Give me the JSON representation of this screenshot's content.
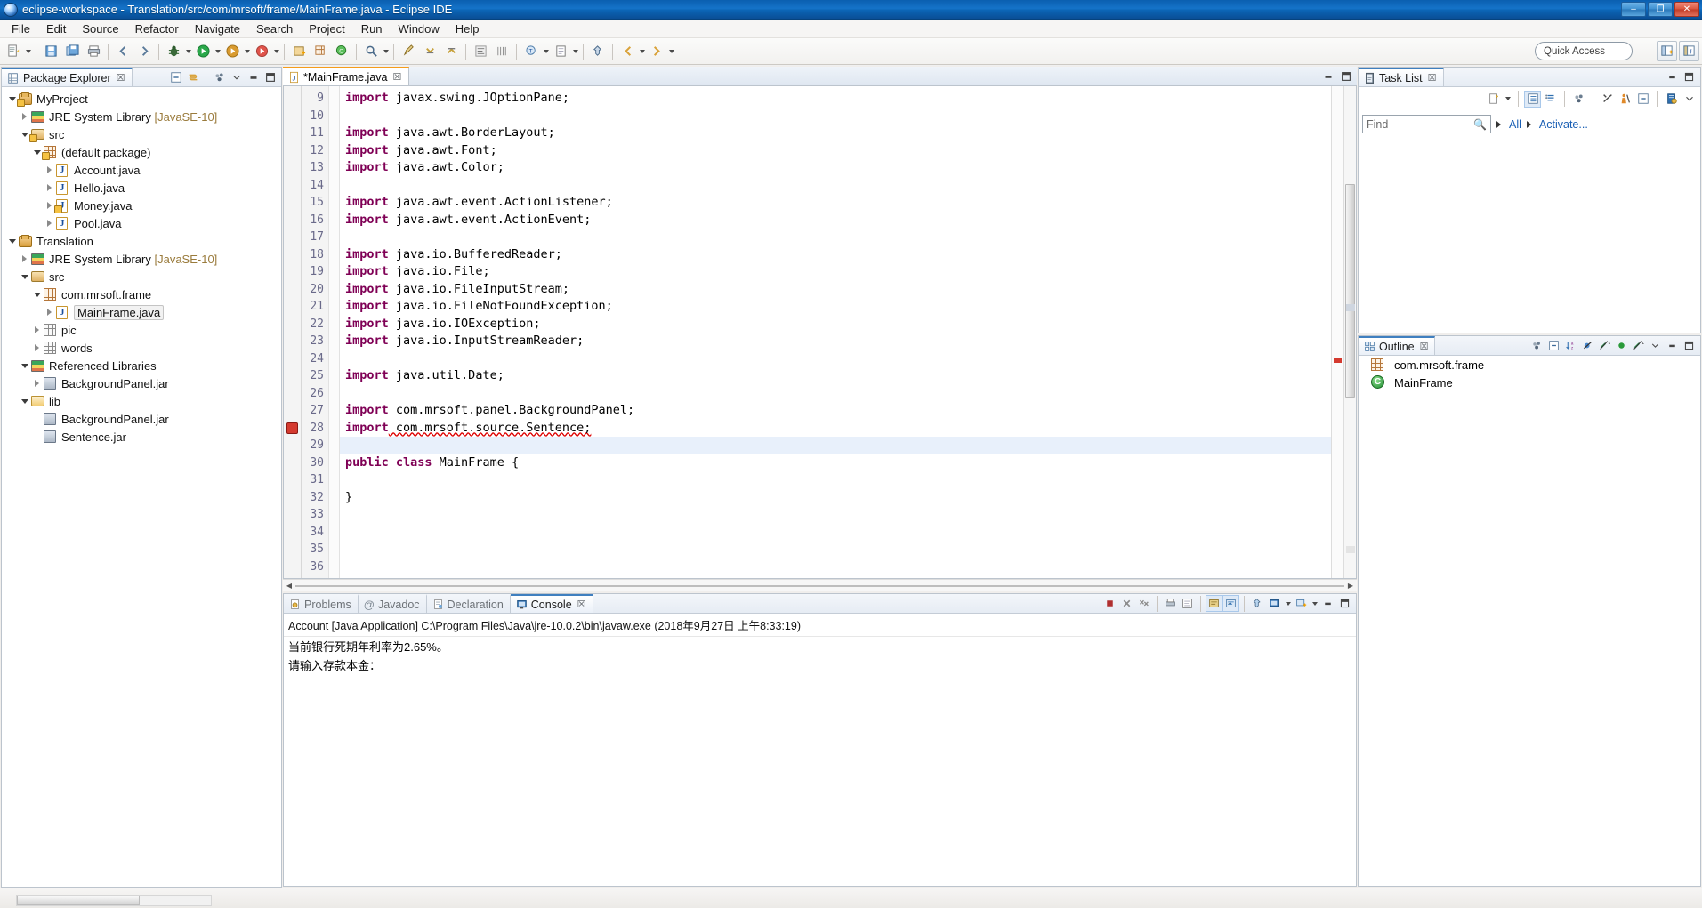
{
  "window": {
    "title": "eclipse-workspace - Translation/src/com/mrsoft/frame/MainFrame.java - Eclipse IDE",
    "minimize_label": "–",
    "maximize_label": "❐",
    "close_label": "✕"
  },
  "menubar": {
    "items": [
      "File",
      "Edit",
      "Source",
      "Refactor",
      "Navigate",
      "Search",
      "Project",
      "Run",
      "Window",
      "Help"
    ]
  },
  "toolbar": {
    "quick_access_placeholder": "Quick Access",
    "icons": [
      "new-icon",
      "new-dropdown",
      "save-icon",
      "save-all-icon",
      "print-icon",
      "debug-icon",
      "run-icon",
      "run-dropdown",
      "coverage-icon",
      "external-tools-icon",
      "new-java-project-icon",
      "new-package-icon",
      "new-class-icon",
      "search-icon",
      "open-type-icon",
      "back-icon",
      "forward-icon"
    ],
    "perspective_buttons": [
      "open-perspective-icon",
      "java-perspective-icon"
    ]
  },
  "package_explorer": {
    "tab_label": "Package Explorer",
    "tab_close": "☒",
    "toolbar_icons": [
      "collapse-all-icon",
      "link-with-editor-icon",
      "view-menu-icon",
      "minimize-icon",
      "maximize-icon"
    ],
    "tree": [
      {
        "label": "MyProject",
        "suffix": "",
        "depth": 0,
        "arrow": "expanded",
        "icon": "project-icon",
        "warn": true
      },
      {
        "label": "JRE System Library ",
        "suffix": "[JavaSE-10]",
        "depth": 1,
        "arrow": "collapsed",
        "icon": "library-icon",
        "warn": false
      },
      {
        "label": "src",
        "suffix": "",
        "depth": 1,
        "arrow": "expanded",
        "icon": "source-folder-icon",
        "warn": true
      },
      {
        "label": "(default package)",
        "suffix": "",
        "depth": 2,
        "arrow": "expanded",
        "icon": "package-icon",
        "warn": true
      },
      {
        "label": "Account.java",
        "suffix": "",
        "depth": 3,
        "arrow": "collapsed",
        "icon": "java-file-icon",
        "warn": false
      },
      {
        "label": "Hello.java",
        "suffix": "",
        "depth": 3,
        "arrow": "collapsed",
        "icon": "java-file-icon",
        "warn": false
      },
      {
        "label": "Money.java",
        "suffix": "",
        "depth": 3,
        "arrow": "collapsed",
        "icon": "java-file-icon",
        "warn": true
      },
      {
        "label": "Pool.java",
        "suffix": "",
        "depth": 3,
        "arrow": "collapsed",
        "icon": "java-file-icon",
        "warn": false
      },
      {
        "label": "Translation",
        "suffix": "",
        "depth": 0,
        "arrow": "expanded",
        "icon": "project-icon",
        "warn": false
      },
      {
        "label": "JRE System Library ",
        "suffix": "[JavaSE-10]",
        "depth": 1,
        "arrow": "collapsed",
        "icon": "library-icon",
        "warn": false
      },
      {
        "label": "src",
        "suffix": "",
        "depth": 1,
        "arrow": "expanded",
        "icon": "source-folder-icon",
        "warn": false
      },
      {
        "label": "com.mrsoft.frame",
        "suffix": "",
        "depth": 2,
        "arrow": "expanded",
        "icon": "package-icon",
        "warn": false
      },
      {
        "label": "MainFrame.java",
        "suffix": "",
        "depth": 3,
        "arrow": "collapsed",
        "icon": "java-file-icon",
        "warn": false,
        "selected": true
      },
      {
        "label": "pic",
        "suffix": "",
        "depth": 2,
        "arrow": "collapsed",
        "icon": "package-gray-icon",
        "warn": false
      },
      {
        "label": "words",
        "suffix": "",
        "depth": 2,
        "arrow": "collapsed",
        "icon": "package-gray-icon",
        "warn": false
      },
      {
        "label": "Referenced Libraries",
        "suffix": "",
        "depth": 1,
        "arrow": "expanded",
        "icon": "library-icon",
        "warn": false
      },
      {
        "label": "BackgroundPanel.jar",
        "suffix": "",
        "depth": 2,
        "arrow": "collapsed",
        "icon": "jar-icon",
        "warn": false
      },
      {
        "label": "lib",
        "suffix": "",
        "depth": 1,
        "arrow": "expanded",
        "icon": "folder-icon",
        "warn": false
      },
      {
        "label": "BackgroundPanel.jar",
        "suffix": "",
        "depth": 2,
        "arrow": "none",
        "icon": "jar-icon",
        "warn": false
      },
      {
        "label": "Sentence.jar",
        "suffix": "",
        "depth": 2,
        "arrow": "none",
        "icon": "jar-icon",
        "warn": false
      }
    ]
  },
  "editor": {
    "tab_label": "*MainFrame.java",
    "tab_close": "☒",
    "first_visible_line": 9,
    "lines": [
      {
        "n": 9,
        "text": "import javax.swing.JOptionPane;",
        "kw": "import"
      },
      {
        "n": 10,
        "text": "",
        "kw": ""
      },
      {
        "n": 11,
        "text": "import java.awt.BorderLayout;",
        "kw": "import"
      },
      {
        "n": 12,
        "text": "import java.awt.Font;",
        "kw": "import"
      },
      {
        "n": 13,
        "text": "import java.awt.Color;",
        "kw": "import"
      },
      {
        "n": 14,
        "text": "",
        "kw": ""
      },
      {
        "n": 15,
        "text": "import java.awt.event.ActionListener;",
        "kw": "import"
      },
      {
        "n": 16,
        "text": "import java.awt.event.ActionEvent;",
        "kw": "import"
      },
      {
        "n": 17,
        "text": "",
        "kw": ""
      },
      {
        "n": 18,
        "text": "import java.io.BufferedReader;",
        "kw": "import"
      },
      {
        "n": 19,
        "text": "import java.io.File;",
        "kw": "import"
      },
      {
        "n": 20,
        "text": "import java.io.FileInputStream;",
        "kw": "import"
      },
      {
        "n": 21,
        "text": "import java.io.FileNotFoundException;",
        "kw": "import"
      },
      {
        "n": 22,
        "text": "import java.io.IOException;",
        "kw": "import"
      },
      {
        "n": 23,
        "text": "import java.io.InputStreamReader;",
        "kw": "import"
      },
      {
        "n": 24,
        "text": "",
        "kw": ""
      },
      {
        "n": 25,
        "text": "import java.util.Date;",
        "kw": "import"
      },
      {
        "n": 26,
        "text": "",
        "kw": ""
      },
      {
        "n": 27,
        "text": "import com.mrsoft.panel.BackgroundPanel;",
        "kw": "import"
      },
      {
        "n": 28,
        "text": "import com.mrsoft.source.Sentence;",
        "kw": "import",
        "error": true
      },
      {
        "n": 29,
        "text": "",
        "kw": "",
        "highlight": true
      },
      {
        "n": 30,
        "text": "public class MainFrame {",
        "kw": "public class"
      },
      {
        "n": 31,
        "text": "",
        "kw": ""
      },
      {
        "n": 32,
        "text": "}",
        "kw": ""
      },
      {
        "n": 33,
        "text": "",
        "kw": ""
      },
      {
        "n": 34,
        "text": "",
        "kw": ""
      },
      {
        "n": 35,
        "text": "",
        "kw": ""
      },
      {
        "n": 36,
        "text": "",
        "kw": ""
      }
    ],
    "error_marker_line": 28,
    "error_marker_color": "#d43a2f"
  },
  "console": {
    "tabs": [
      {
        "label": "Problems",
        "icon": "problems-icon",
        "active": false
      },
      {
        "label": "Javadoc",
        "icon": "javadoc-icon",
        "active": false
      },
      {
        "label": "Declaration",
        "icon": "declaration-icon",
        "active": false
      },
      {
        "label": "Console",
        "icon": "console-icon",
        "active": true
      }
    ],
    "tab_close": "☒",
    "header": "Account [Java Application] C:\\Program Files\\Java\\jre-10.0.2\\bin\\javaw.exe (2018年9月27日 上午8:33:19)",
    "output": [
      "当前银行死期年利率为2.65%。",
      "请输入存款本金："
    ],
    "toolbar_icons": [
      "terminate-icon",
      "remove-launch-icon",
      "remove-all-icon",
      "open-console-icon",
      "display-selected-console-icon",
      "scroll-lock-icon",
      "word-wrap-icon",
      "pin-console-icon",
      "new-console-view-icon",
      "console-dropdown-icon",
      "minimize-icon",
      "maximize-icon"
    ]
  },
  "task_list": {
    "tab_label": "Task List",
    "tab_close": "☒",
    "find_placeholder": "Find",
    "filter_all": "All",
    "filter_activate": "Activate...",
    "help_label": "?",
    "toolbar_icons": [
      "new-task-icon",
      "new-task-dropdown",
      "categorized-presentation-icon",
      "scheduled-presentation-icon",
      "focus-on-workweek-icon",
      "collapse-all-icon",
      "synchronize-changed-icon",
      "restore-tasks-icon",
      "view-menu-icon",
      "minimize-icon",
      "maximize-icon"
    ]
  },
  "outline": {
    "tab_label": "Outline",
    "tab_close": "☒",
    "toolbar_icons": [
      "focus-on-active-task-icon",
      "collapse-all-icon",
      "sort-icon",
      "hide-fields-icon",
      "hide-static-icon",
      "hide-non-public-icon",
      "hide-local-types-icon",
      "view-menu-icon",
      "minimize-icon",
      "maximize-icon"
    ],
    "items": [
      {
        "label": "com.mrsoft.frame",
        "icon": "package-icon"
      },
      {
        "label": "MainFrame",
        "icon": "class-icon"
      }
    ]
  },
  "statusbar": {
    "text": ""
  },
  "colors": {
    "title_blue": "#1573c9",
    "keyword_purple": "#7f0055",
    "error_red": "#d43a2f",
    "link_blue": "#1a5fb4",
    "selection_blue": "#e8f0fb",
    "tab_orange": "#f59c1a"
  }
}
